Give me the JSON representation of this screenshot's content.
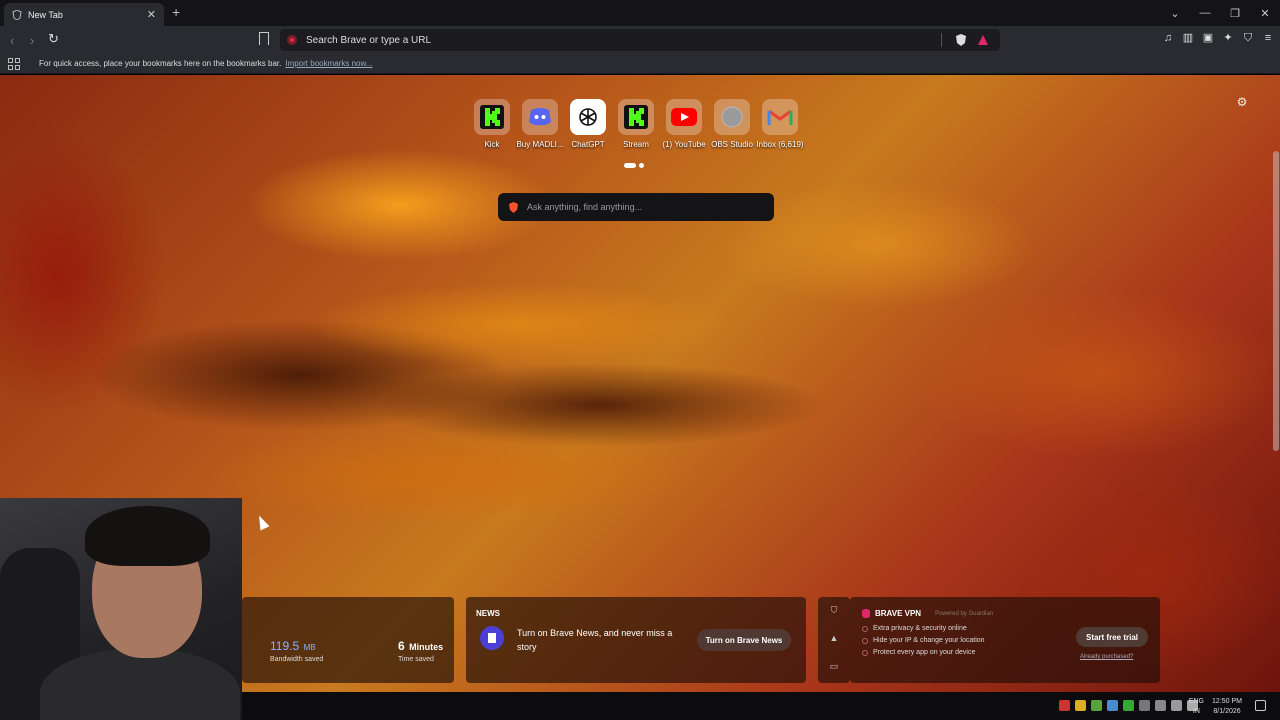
{
  "browser": {
    "tab_title": "New Tab",
    "new_tab_symbol": "+",
    "omnibox_placeholder": "Search Brave or type a URL",
    "bookmarks_bar_text": "For quick access, place your bookmarks here on the bookmarks bar.",
    "bookmarks_import_link": "Import bookmarks now..."
  },
  "top_sites": [
    {
      "label": "Kick",
      "icon": "kick-icon",
      "color": "#53fc18"
    },
    {
      "label": "Buy MADLI...",
      "icon": "discord-icon",
      "color": "#5865f2"
    },
    {
      "label": "ChatGPT",
      "icon": "chatgpt-icon",
      "color": "#ffffff"
    },
    {
      "label": "Stream",
      "icon": "kick-icon",
      "color": "#53fc18"
    },
    {
      "label": "(1) YouTube",
      "icon": "youtube-icon",
      "color": "#ff0000"
    },
    {
      "label": "OBS Studio",
      "icon": "globe-icon",
      "color": "#9a9a9a"
    },
    {
      "label": "Inbox (6,619)",
      "icon": "gmail-icon",
      "color": "#ea4335"
    }
  ],
  "ask_box": {
    "placeholder": "Ask anything, find anything..."
  },
  "stats": {
    "bandwidth_value": "119.5",
    "bandwidth_unit": "MB",
    "bandwidth_caption": "Bandwidth saved",
    "time_value": "6",
    "time_unit": "Minutes",
    "time_caption": "Time saved"
  },
  "news": {
    "heading": "NEWS",
    "message": "Turn on Brave News, and never miss a story",
    "button": "Turn on Brave News"
  },
  "vpn": {
    "title": "BRAVE VPN",
    "powered_by": "Powered by Guardian",
    "features": [
      "Extra privacy & security online",
      "Hide your IP & change your location",
      "Protect every app on your device"
    ],
    "button": "Start free trial",
    "link": "Already purchased?"
  },
  "taskbar": {
    "lang_top": "ENG",
    "lang_bottom": "IN",
    "time": "12:50 PM",
    "date": "8/1/2026"
  },
  "colors": {
    "accent_blue": "#8fb0ff",
    "brave_orange": "#fb542b",
    "vpn_pink": "#e0286a"
  }
}
